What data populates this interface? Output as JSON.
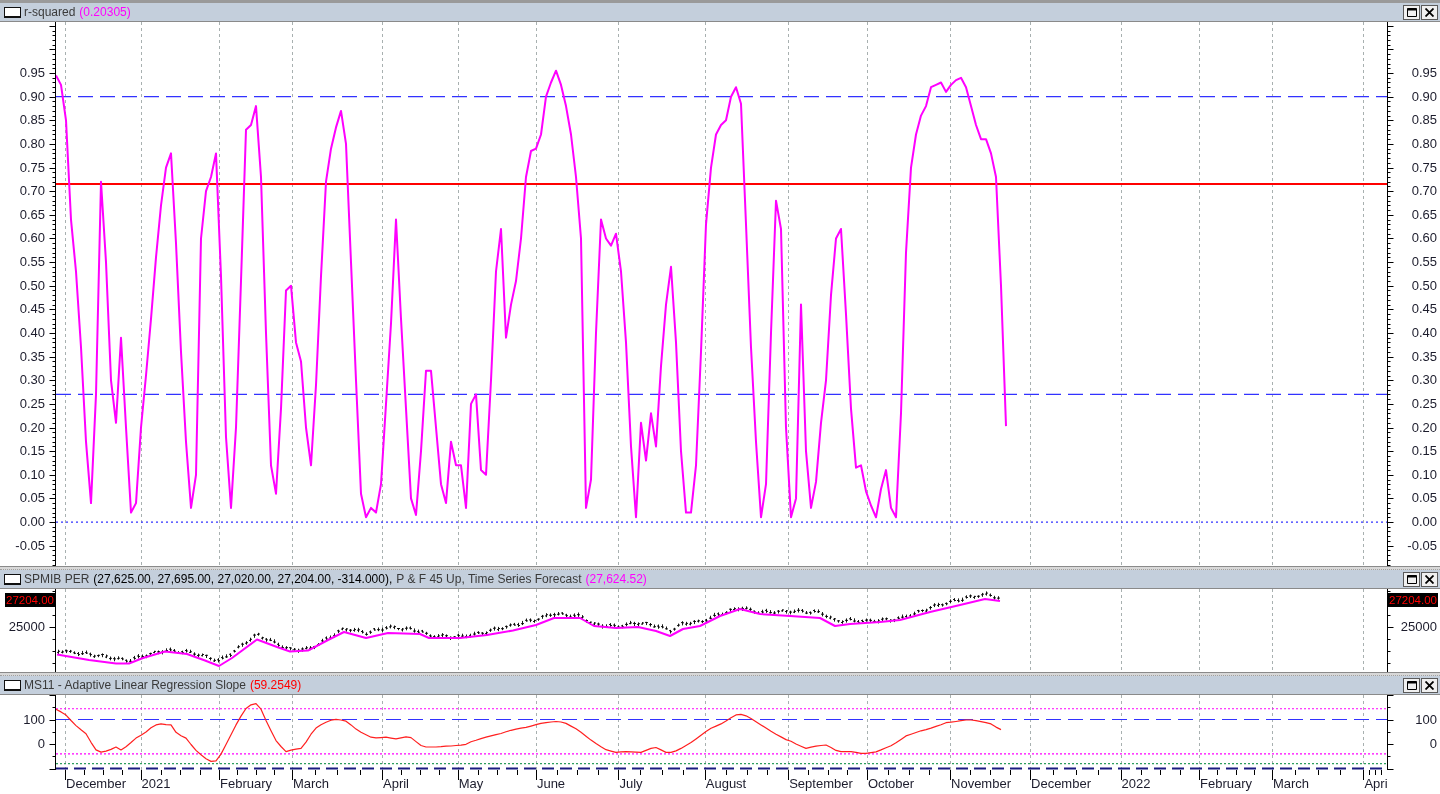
{
  "panes": [
    {
      "kind": "indicator",
      "title_parts": [
        {
          "text": "r-squared",
          "color": "#3a3a3a"
        },
        {
          "text": "(0.20305)",
          "color": "#ff00ff"
        }
      ],
      "right_axis": {
        "labels": [
          "0.95",
          "0.90",
          "0.85",
          "0.80",
          "0.75",
          "0.70",
          "0.65",
          "0.60",
          "0.55",
          "0.50",
          "0.45",
          "0.40",
          "0.35",
          "0.30",
          "0.25",
          "0.20",
          "0.15",
          "0.10",
          "0.05",
          "0.00",
          "-0.05"
        ]
      },
      "chart_data": {
        "type": "line",
        "categories": [
          null,
          null,
          null,
          null,
          null,
          null,
          null,
          null,
          null,
          null,
          null,
          null,
          null,
          null,
          null,
          null,
          null,
          null,
          null,
          null,
          null,
          null,
          null,
          null,
          null,
          null,
          null,
          null,
          null,
          null,
          null,
          null,
          null,
          null,
          null,
          null,
          null,
          null,
          null,
          null,
          null,
          null,
          null,
          null,
          null,
          null,
          null,
          null,
          null,
          null,
          null,
          null,
          null,
          null,
          null,
          null,
          null,
          null,
          null,
          null,
          null,
          null,
          null,
          null,
          null,
          null,
          null,
          null,
          null,
          null,
          null,
          null,
          null,
          null,
          null,
          null,
          null,
          null,
          null,
          null,
          null,
          null,
          null,
          null,
          null,
          null,
          null,
          null,
          null,
          null,
          null,
          null,
          null,
          null,
          null,
          null,
          null,
          null,
          null,
          null,
          null,
          null,
          null,
          null,
          null,
          null,
          null,
          null,
          null,
          null,
          null,
          null,
          null,
          null,
          null,
          null,
          null,
          null,
          null,
          null,
          null,
          null,
          null,
          null,
          null,
          null,
          null,
          null,
          null,
          null,
          null,
          null,
          null,
          null,
          null,
          null,
          null,
          null,
          null,
          null,
          null,
          null,
          null,
          null,
          null,
          null,
          null,
          null,
          null,
          null,
          null,
          null,
          null,
          null,
          null,
          null,
          null,
          null,
          null,
          null,
          null,
          null,
          null,
          null,
          null,
          null,
          null,
          null,
          null,
          null,
          null,
          null,
          null,
          null,
          null,
          null,
          null,
          null,
          null,
          null,
          null,
          null,
          null,
          null,
          null,
          null,
          null,
          null,
          null,
          null,
          null,
          null,
          null,
          null,
          null,
          null,
          null,
          null,
          null,
          null,
          null,
          null,
          null,
          null,
          null,
          null,
          null,
          null,
          null,
          null,
          null,
          null,
          null,
          null,
          null,
          null,
          null,
          null,
          null,
          null,
          null,
          null,
          null,
          null,
          null,
          null,
          null,
          null,
          null,
          null,
          null,
          null,
          null,
          null,
          null,
          null,
          null,
          null,
          null,
          null,
          null,
          null,
          null,
          null,
          null,
          null,
          null,
          null,
          null,
          null,
          null,
          null,
          null,
          null,
          null,
          null,
          null,
          null,
          null,
          null,
          null,
          null,
          null,
          null,
          null,
          null,
          null
        ],
        "values": [
          0.945,
          0.925,
          0.85,
          0.64,
          0.53,
          0.37,
          0.17,
          0.04,
          0.27,
          0.72,
          0.55,
          0.3,
          0.21,
          0.39,
          0.2,
          0.02,
          0.04,
          0.2,
          0.31,
          0.43,
          0.56,
          0.67,
          0.75,
          0.78,
          0.59,
          0.36,
          0.17,
          0.03,
          0.1,
          0.6,
          0.7,
          0.73,
          0.78,
          0.52,
          0.18,
          0.03,
          0.2,
          0.51,
          0.83,
          0.84,
          0.88,
          0.73,
          0.4,
          0.12,
          0.06,
          0.24,
          0.49,
          0.5,
          0.38,
          0.34,
          0.2,
          0.12,
          0.29,
          0.52,
          0.72,
          0.79,
          0.835,
          0.87,
          0.8,
          0.55,
          0.3,
          0.06,
          0.01,
          0.03,
          0.02,
          0.08,
          0.25,
          0.42,
          0.64,
          0.43,
          0.24,
          0.05,
          0.015,
          0.15,
          0.32,
          0.32,
          0.2,
          0.08,
          0.04,
          0.17,
          0.12,
          0.12,
          0.03,
          0.25,
          0.27,
          0.11,
          0.1,
          0.3,
          0.53,
          0.62,
          0.39,
          0.46,
          0.51,
          0.6,
          0.73,
          0.785,
          0.79,
          0.82,
          0.9,
          0.93,
          0.955,
          0.925,
          0.88,
          0.82,
          0.73,
          0.6,
          0.03,
          0.09,
          0.4,
          0.64,
          0.6,
          0.585,
          0.61,
          0.53,
          0.38,
          0.16,
          0.01,
          0.21,
          0.13,
          0.23,
          0.16,
          0.33,
          0.46,
          0.54,
          0.38,
          0.15,
          0.02,
          0.02,
          0.12,
          0.36,
          0.63,
          0.75,
          0.82,
          0.84,
          0.85,
          0.9,
          0.92,
          0.885,
          0.63,
          0.37,
          0.17,
          0.01,
          0.08,
          0.4,
          0.68,
          0.62,
          0.2,
          0.01,
          0.05,
          0.46,
          0.15,
          0.03,
          0.085,
          0.21,
          0.3,
          0.48,
          0.6,
          0.62,
          0.44,
          0.24,
          0.115,
          0.12,
          0.065,
          0.035,
          0.01,
          0.07,
          0.11,
          0.03,
          0.01,
          0.23,
          0.57,
          0.75,
          0.82,
          0.86,
          0.88,
          0.92,
          0.925,
          0.93,
          0.91,
          0.925,
          0.935,
          0.94,
          0.92,
          0.88,
          0.84,
          0.81,
          0.81,
          0.78,
          0.73,
          0.5,
          0.203,
          null,
          null,
          null,
          null,
          null,
          null,
          null,
          null,
          null,
          null,
          null,
          null,
          null,
          null,
          null,
          null,
          null,
          null,
          null,
          null,
          null,
          null,
          null,
          null,
          null,
          null,
          null,
          null,
          null,
          null,
          null,
          null,
          null,
          null,
          null,
          null,
          null,
          null,
          null,
          null,
          null,
          null,
          null,
          null,
          null,
          null,
          null,
          null,
          null,
          null,
          null,
          null,
          null,
          null,
          null,
          null,
          null,
          null,
          null,
          null,
          null,
          null,
          null,
          null,
          null,
          null,
          null,
          null,
          null,
          null,
          null,
          null,
          null,
          null,
          null,
          null
        ],
        "ylim": [
          -0.093,
          1.058
        ],
        "yticks": [
          {
            "value": 0.95,
            "label": "0.95"
          },
          {
            "value": 0.9,
            "label": "0.90"
          },
          {
            "value": 0.85,
            "label": "0.85"
          },
          {
            "value": 0.8,
            "label": "0.80"
          },
          {
            "value": 0.75,
            "label": "0.75"
          },
          {
            "value": 0.7,
            "label": "0.70"
          },
          {
            "value": 0.65,
            "label": "0.65"
          },
          {
            "value": 0.6,
            "label": "0.60"
          },
          {
            "value": 0.55,
            "label": "0.55"
          },
          {
            "value": 0.5,
            "label": "0.50"
          },
          {
            "value": 0.45,
            "label": "0.45"
          },
          {
            "value": 0.4,
            "label": "0.40"
          },
          {
            "value": 0.35,
            "label": "0.35"
          },
          {
            "value": 0.3,
            "label": "0.30"
          },
          {
            "value": 0.25,
            "label": "0.25"
          },
          {
            "value": 0.2,
            "label": "0.20"
          },
          {
            "value": 0.15,
            "label": "0.15"
          },
          {
            "value": 0.1,
            "label": "0.10"
          },
          {
            "value": 0.05,
            "label": "0.05"
          },
          {
            "value": 0,
            "label": "0.00"
          },
          {
            "value": -0.05,
            "label": "-0.05"
          }
        ],
        "ref_lines": [
          {
            "axis": "y",
            "value": 0.9,
            "color": "#3232ff"
          },
          {
            "axis": "y",
            "value": 0.715,
            "color": "#ff0000"
          },
          {
            "axis": "y",
            "value": 0.27,
            "color": "#3232ff"
          },
          {
            "axis": "y",
            "value": 0,
            "color": "#3232ff"
          }
        ]
      }
    },
    {
      "kind": "price",
      "title_parts": [
        {
          "text": "SPMIB PER",
          "color": "#3a3a3a"
        },
        {
          "text": "(27,625.00, 27,695.00, 27,020.00, 27,204.00, -314.000),",
          "color": "#000000"
        },
        {
          "text": "P & F 45 Up, Time Series Forecast",
          "color": "#3a3a3a"
        },
        {
          "text": "(27,624.52)",
          "color": "#ff00ff"
        }
      ],
      "left_axis": {
        "badge": "27204.00",
        "labels": [
          "25000"
        ]
      },
      "right_axis": {
        "badge": "27204.00",
        "labels": [
          "25000"
        ]
      }
    },
    {
      "kind": "oscillator",
      "title_parts": [
        {
          "text": "MS11 - Adaptive Linear Regression Slope",
          "color": "#3a3a3a"
        },
        {
          "text": "(59.2549)",
          "color": "#ff0000"
        }
      ],
      "right_axis": {
        "labels": [
          "100",
          "0"
        ]
      },
      "chart_data": {
        "type": "line",
        "categories": [
          null,
          null,
          null,
          null,
          null,
          null,
          null,
          null,
          "December",
          null,
          null,
          null,
          null,
          null,
          null,
          null,
          null,
          null,
          null,
          null,
          "2021",
          null,
          null,
          null,
          null,
          null,
          null,
          null,
          null,
          null,
          null,
          null,
          null,
          null,
          null,
          null,
          null,
          null,
          "February",
          null,
          null,
          null,
          null,
          null,
          null,
          null,
          null,
          null,
          null,
          null,
          null,
          "March",
          null,
          null,
          null,
          null,
          null,
          null,
          null,
          null,
          null,
          null,
          null,
          null,
          null,
          null,
          null,
          null,
          "April",
          null,
          null,
          null,
          null,
          null,
          null,
          null,
          null,
          null,
          null,
          null,
          null,
          null,
          null,
          "May",
          null,
          null,
          null,
          null,
          null,
          null,
          null,
          null,
          null,
          null,
          null,
          null,
          null,
          null,
          null,
          "June",
          null,
          null,
          null,
          null,
          null,
          null,
          null,
          null,
          null,
          null,
          null,
          null,
          null,
          null,
          null,
          "July",
          null,
          null,
          null,
          null,
          null,
          null,
          null,
          null,
          null,
          null,
          null,
          null,
          null,
          null,
          null,
          null,
          null,
          null,
          "August",
          null,
          null,
          null,
          null,
          null,
          null,
          null,
          null,
          null,
          null,
          null,
          null,
          null,
          null,
          null,
          null,
          null,
          null,
          "September",
          null,
          null,
          null,
          null,
          null,
          null,
          null,
          null,
          null,
          null,
          null,
          null,
          null,
          "October",
          null,
          null,
          null,
          null,
          null,
          null,
          null,
          null,
          null,
          null,
          null,
          null,
          null,
          null,
          null,
          null,
          null,
          "November",
          null,
          null,
          null,
          null,
          null,
          null,
          null,
          null,
          null,
          null,
          null,
          null,
          null,
          null,
          null,
          "December",
          null,
          null,
          null,
          null,
          null,
          null,
          null,
          null,
          null,
          null,
          null,
          null,
          null,
          null,
          "2022",
          null,
          null,
          null,
          null,
          null,
          null,
          null,
          null,
          null,
          null,
          null,
          null,
          null,
          null,
          null,
          null,
          null,
          "February",
          null,
          null,
          null,
          null,
          null,
          null,
          null,
          null,
          null,
          null,
          null,
          null,
          "March",
          null,
          null,
          null,
          null,
          null,
          null,
          null,
          null,
          null,
          null,
          null,
          null,
          null,
          null,
          null,
          null,
          "Apri",
          null,
          null
        ],
        "values": [
          142,
          131,
          118,
          96,
          75,
          58,
          42,
          7,
          -24,
          -33,
          -29,
          -22,
          -12,
          -24,
          -11,
          6,
          24,
          36,
          49,
          66,
          78,
          82,
          79,
          78,
          48,
          34,
          24,
          -2,
          -26,
          -44,
          -60,
          -71,
          -69,
          -41,
          -2,
          38,
          78,
          114,
          145,
          160,
          165,
          142,
          96,
          54,
          14,
          -10,
          -31,
          -25,
          -21,
          -18,
          8,
          40,
          65,
          79,
          89,
          97,
          101,
          98,
          93,
          78,
          61,
          48,
          38,
          28,
          25,
          26,
          28,
          24,
          21,
          25,
          29,
          26,
          10,
          -6,
          -12,
          -12,
          -12,
          -11,
          -9,
          -8,
          -6,
          -5,
          -1,
          9,
          15,
          22,
          28,
          33,
          38,
          43,
          50,
          56,
          61,
          65,
          68,
          73,
          79,
          84,
          87,
          90,
          92,
          90,
          84,
          73,
          62,
          48,
          32,
          16,
          2,
          -11,
          -23,
          -29,
          -34,
          -32,
          -31,
          -32,
          -33,
          -34,
          -26,
          -18,
          -14,
          -24,
          -34,
          -34,
          -28,
          -18,
          -6,
          6,
          21,
          36,
          51,
          64,
          73,
          82,
          94,
          107,
          119,
          121,
          115,
          104,
          91,
          78,
          65,
          52,
          40,
          29,
          18,
          11,
          0,
          -9,
          -18,
          -13,
          -9,
          -6,
          -4,
          -14,
          -26,
          -31,
          -31,
          -31,
          -34,
          -38,
          -38,
          -35,
          -32,
          -24,
          -15,
          -7,
          5,
          19,
          33,
          40,
          47,
          54,
          59,
          65,
          72,
          79,
          87,
          89,
          92,
          95,
          98,
          98,
          95,
          91,
          87,
          82,
          69,
          59,
          null,
          null,
          null,
          null,
          null,
          null,
          null,
          null,
          null,
          null,
          null,
          null,
          null,
          null,
          null,
          null,
          null,
          null,
          null,
          null,
          null,
          null,
          null,
          null,
          null,
          null,
          null,
          null,
          null,
          null,
          null,
          null,
          null,
          null,
          null,
          null,
          null,
          null,
          null,
          null,
          null,
          null,
          null,
          null,
          null,
          null,
          null,
          null,
          null,
          null,
          null,
          null,
          null,
          null,
          null,
          null,
          null,
          null,
          null,
          null,
          null,
          null,
          null,
          null,
          null,
          null,
          null,
          null,
          null,
          null,
          null,
          null,
          null,
          null,
          null,
          null,
          null
        ],
        "ylim": [
          -106,
          200
        ],
        "yticks": [
          {
            "value": 100,
            "label": "100"
          },
          {
            "value": 0,
            "label": "0"
          }
        ],
        "ref_lines": [
          {
            "axis": "y",
            "value": 144,
            "color": "#ff00ff"
          },
          {
            "axis": "y",
            "value": 100,
            "color": "#3232ff"
          },
          {
            "axis": "y",
            "value": -40,
            "color": "#ff00ff"
          },
          {
            "axis": "y",
            "value": -80,
            "color": "#2e9e5e"
          },
          {
            "axis": "y",
            "value": -100,
            "color": "#1a1a80"
          }
        ]
      }
    }
  ]
}
